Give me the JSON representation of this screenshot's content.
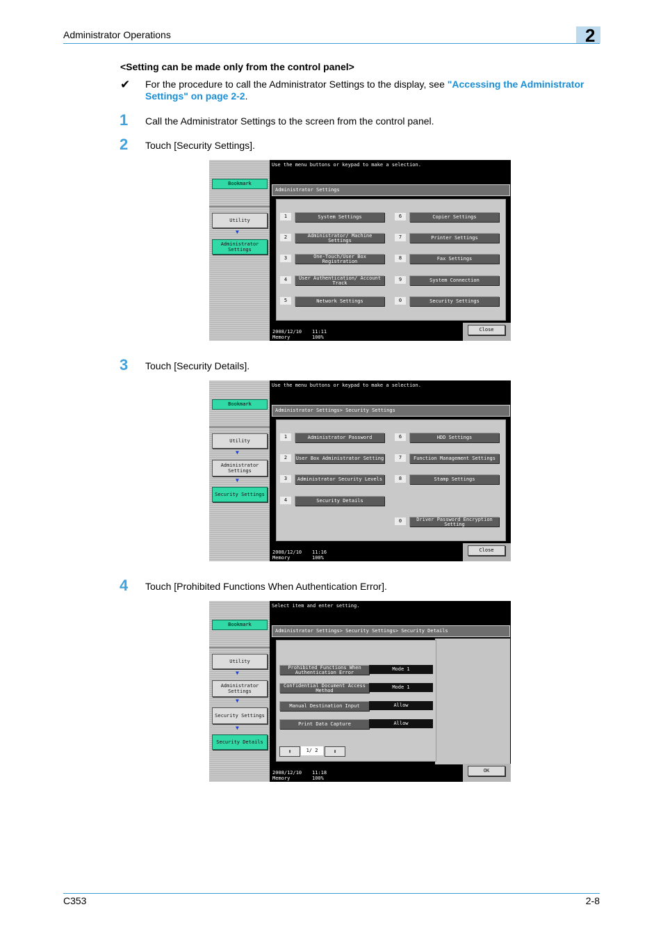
{
  "header": {
    "section_title": "Administrator Operations",
    "chapter_number": "2"
  },
  "footer": {
    "model": "C353",
    "page": "2-8"
  },
  "heading": "<Setting can be made only from the control panel>",
  "note": {
    "check_symbol": "✔",
    "text_before": "For the procedure to call the Administrator Settings to the display, see ",
    "link_text": "\"Accessing the Administrator Settings\" on page 2-2",
    "text_after": "."
  },
  "steps": [
    {
      "number": "1",
      "text": "Call the Administrator Settings to the screen from the control panel."
    },
    {
      "number": "2",
      "text": "Touch [Security Settings]."
    },
    {
      "number": "3",
      "text": "Touch [Security Details]."
    },
    {
      "number": "4",
      "text": "Touch [Prohibited Functions When Authentication Error]."
    }
  ],
  "screens": {
    "s1": {
      "instruction": "Use the menu buttons or keypad to make a selection.",
      "title": "Administrator Settings",
      "bookmark": "Bookmark",
      "sidebar": [
        "Utility",
        "Administrator Settings"
      ],
      "menu": [
        {
          "num": "1",
          "label": "System Settings"
        },
        {
          "num": "2",
          "label": "Administrator/ Machine Settings"
        },
        {
          "num": "3",
          "label": "One-Touch/User Box Registration"
        },
        {
          "num": "4",
          "label": "User Authentication/ Account Track"
        },
        {
          "num": "5",
          "label": "Network Settings"
        },
        {
          "num": "6",
          "label": "Copier Settings"
        },
        {
          "num": "7",
          "label": "Printer Settings"
        },
        {
          "num": "8",
          "label": "Fax Settings"
        },
        {
          "num": "9",
          "label": "System Connection"
        },
        {
          "num": "0",
          "label": "Security Settings"
        }
      ],
      "date": "2008/12/10",
      "time": "11:11",
      "memory_label": "Memory",
      "memory_value": "100%",
      "action": "Close"
    },
    "s2": {
      "instruction": "Use the menu buttons or keypad to make a selection.",
      "title": "Administrator Settings> Security Settings",
      "bookmark": "Bookmark",
      "sidebar": [
        "Utility",
        "Administrator Settings",
        "Security Settings"
      ],
      "menu": [
        {
          "num": "1",
          "label": "Administrator Password"
        },
        {
          "num": "2",
          "label": "User Box Administrator Setting"
        },
        {
          "num": "3",
          "label": "Administrator Security Levels"
        },
        {
          "num": "4",
          "label": "Security Details"
        },
        {
          "num": "6",
          "label": "HDD Settings"
        },
        {
          "num": "7",
          "label": "Function Management Settings"
        },
        {
          "num": "8",
          "label": "Stamp Settings"
        },
        {
          "num": "0",
          "label": "Driver Password Encryption Setting"
        }
      ],
      "date": "2008/12/10",
      "time": "11:16",
      "memory_label": "Memory",
      "memory_value": "100%",
      "action": "Close"
    },
    "s3": {
      "instruction": "Select item and enter setting.",
      "title": "Administrator Settings> Security Settings> Security Details",
      "bookmark": "Bookmark",
      "sidebar": [
        "Utility",
        "Administrator Settings",
        "Security Settings",
        "Security Details"
      ],
      "rows": [
        {
          "label": "Prohibited Functions When Authentication Error",
          "value": "Mode 1"
        },
        {
          "label": "Confidential Document Access Method",
          "value": "Mode 1"
        },
        {
          "label": "Manual Destination Input",
          "value": "Allow"
        },
        {
          "label": "Print Data Capture",
          "value": "Allow"
        }
      ],
      "pager": "1/ 2",
      "date": "2008/12/10",
      "time": "11:18",
      "memory_label": "Memory",
      "memory_value": "100%",
      "action": "OK"
    }
  }
}
